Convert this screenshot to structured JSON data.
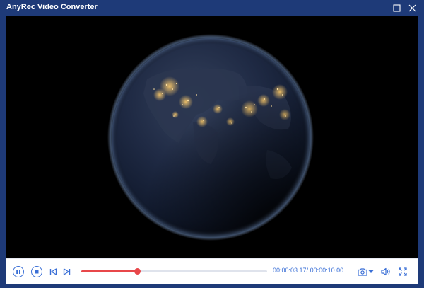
{
  "window": {
    "title": "AnyRec Video Converter"
  },
  "playback": {
    "current_time": "00:00:03.17",
    "separator": "/ ",
    "total_time": "00:00:10.00",
    "progress": 0.3
  },
  "colors": {
    "accent": "#3a6fd6",
    "progress": "#e8474a",
    "titlebar": "#1e3a78"
  },
  "icons": {
    "maximize": "maximize-icon",
    "close": "close-icon",
    "pause": "pause-icon",
    "stop": "stop-icon",
    "previous": "skip-previous-icon",
    "next": "skip-next-icon",
    "snapshot": "camera-icon",
    "snapshot_menu": "chevron-down-icon",
    "volume": "volume-icon",
    "fullscreen": "fullscreen-icon"
  }
}
